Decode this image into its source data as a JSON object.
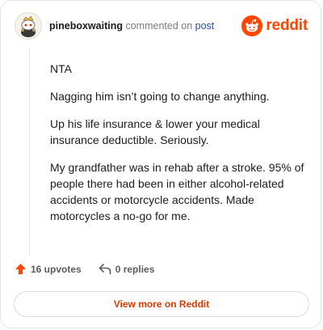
{
  "comment": {
    "username": "pineboxwaiting",
    "verb": "commented on",
    "post_link": "post",
    "paragraphs": [
      "NTA",
      "Nagging him isn’t going to change anything.",
      "Up his life insurance & lower your medical insurance deductible. Seriously.",
      "My grandfather was in rehab after a stroke. 95% of people there had been in either alcohol-related accidents or motorcycle accidents. Made motorcycles a no-go for me."
    ]
  },
  "brand": {
    "name": "reddit",
    "color": "#ff4500"
  },
  "stats": {
    "upvotes": "16 upvotes",
    "replies": "0 replies",
    "upvote_icon": "upvote-arrow-icon",
    "reply_icon": "reply-arrow-icon"
  },
  "actions": {
    "view_more": "View more on Reddit"
  }
}
